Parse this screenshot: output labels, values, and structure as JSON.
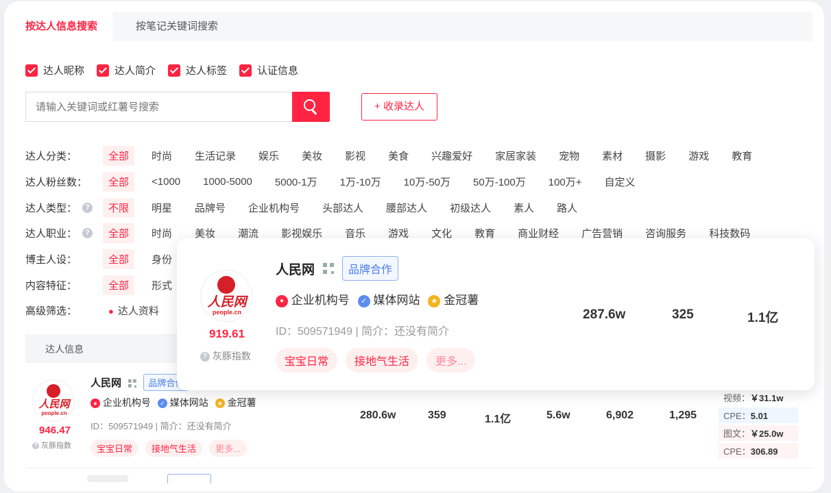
{
  "tabs": [
    "按达人信息搜索",
    "按笔记关键词搜索"
  ],
  "checkboxes": [
    "达人昵称",
    "达人简介",
    "达人标签",
    "认证信息"
  ],
  "search": {
    "placeholder": "请输入关键词或红薯号搜索",
    "add_label": "+ 收录达人"
  },
  "filters": [
    {
      "label": "达人分类：",
      "help": false,
      "options": [
        "全部",
        "时尚",
        "生活记录",
        "娱乐",
        "美妆",
        "影视",
        "美食",
        "兴趣爱好",
        "家居家装",
        "宠物",
        "素材",
        "摄影",
        "游戏",
        "教育"
      ]
    },
    {
      "label": "达人粉丝数：",
      "help": false,
      "options": [
        "全部",
        "<1000",
        "1000-5000",
        "5000-1万",
        "1万-10万",
        "10万-50万",
        "50万-100万",
        "100万+",
        "自定义"
      ]
    },
    {
      "label": "达人类型：",
      "help": true,
      "options": [
        "不限",
        "明星",
        "品牌号",
        "企业机构号",
        "头部达人",
        "腰部达人",
        "初级达人",
        "素人",
        "路人"
      ]
    },
    {
      "label": "达人职业：",
      "help": true,
      "options": [
        "全部",
        "时尚",
        "美妆",
        "潮流",
        "影视娱乐",
        "音乐",
        "游戏",
        "文化",
        "教育",
        "商业财经",
        "广告营销",
        "咨询服务",
        "科技数码"
      ]
    },
    {
      "label": "博主人设：",
      "help": false,
      "options": [
        "全部",
        "身份"
      ]
    },
    {
      "label": "内容特征：",
      "help": false,
      "options": [
        "全部",
        "形式"
      ]
    }
  ],
  "advanced": {
    "label": "高级筛选：",
    "item": "达人资料"
  },
  "table": {
    "header": "达人信息"
  },
  "row": {
    "logo_text": "人民网",
    "logo_sub": "people.cn",
    "name": "人民网",
    "brand": "品牌合作",
    "badges": [
      "企业机构号",
      "媒体网站",
      "金冠薯"
    ],
    "id_line": "ID：509571949 | 简介：还没有简介",
    "tags": [
      "宝宝日常",
      "接地气生活",
      "更多..."
    ],
    "score": "946.47",
    "score_label": "灰豚指数",
    "stats": [
      "280.6w",
      "359",
      "1.1亿",
      "5.6w",
      "6,902",
      "1,295"
    ],
    "prices": [
      {
        "label": "视频：",
        "value": "￥31.1w"
      },
      {
        "label": "CPE：",
        "value": "5.01"
      },
      {
        "label": "图文：",
        "value": "￥25.0w"
      },
      {
        "label": "CPE：",
        "value": "306.89"
      }
    ]
  },
  "popup": {
    "logo_text": "人民网",
    "logo_sub": "people.cn",
    "name": "人民网",
    "brand": "品牌合作",
    "badges": [
      "企业机构号",
      "媒体网站",
      "金冠薯"
    ],
    "id_line": "ID：509571949 | 简介：还没有简介",
    "tags": [
      "宝宝日常",
      "接地气生活",
      "更多..."
    ],
    "score": "919.61",
    "score_label": "灰豚指数",
    "stats": [
      "287.6w",
      "325",
      "1.1亿"
    ]
  },
  "colors": {
    "accent": "#ff2442",
    "brand_blue": "#4a7ee8"
  }
}
